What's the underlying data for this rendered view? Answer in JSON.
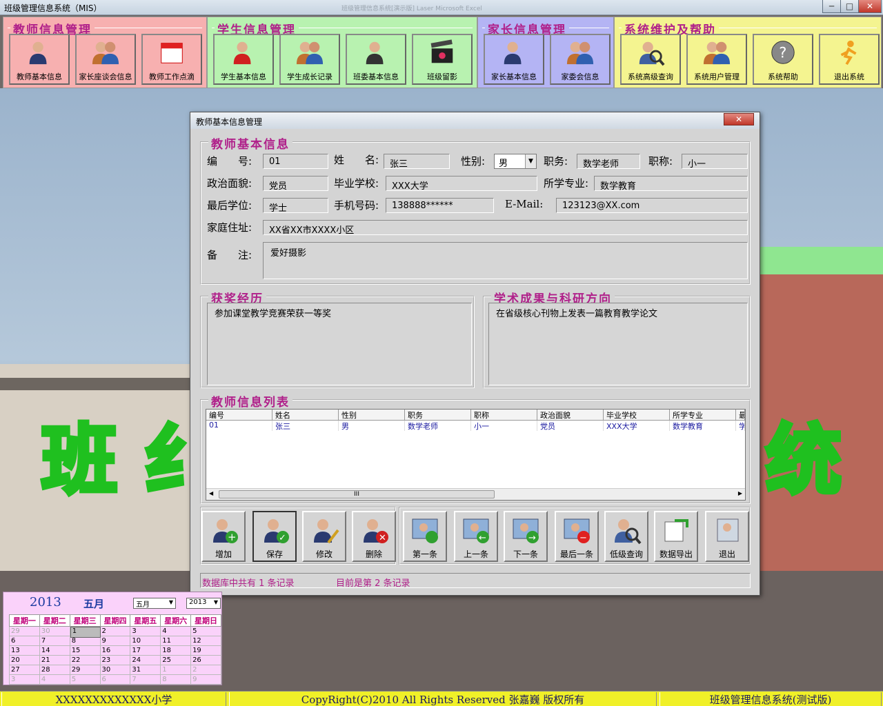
{
  "app": {
    "title": "班级管理信息系统（MIS）",
    "ghost_title": "班级管理信息系统[演示版] Laser    Microsoft Excel",
    "controls": {
      "minimize": "─",
      "maximize": "□",
      "close": "✕"
    }
  },
  "groups": [
    {
      "label": "教师信息管理",
      "bg": "#f7b0b0",
      "buttons": [
        {
          "label": "教师基本信息",
          "icon": "teacher-icon"
        },
        {
          "label": "家长座谈会信息",
          "icon": "parents-meeting-icon"
        },
        {
          "label": "教师工作点滴",
          "icon": "calendar-icon"
        }
      ]
    },
    {
      "label": "学生信息管理",
      "bg": "#b8f2b0",
      "buttons": [
        {
          "label": "学生基本信息",
          "icon": "student-icon"
        },
        {
          "label": "学生成长记录",
          "icon": "growth-record-icon"
        },
        {
          "label": "班委基本信息",
          "icon": "class-committee-icon"
        },
        {
          "label": "班级留影",
          "icon": "clapperboard-icon"
        }
      ]
    },
    {
      "label": "家长信息管理",
      "bg": "#b4b4f4",
      "buttons": [
        {
          "label": "家长基本信息",
          "icon": "parent-icon"
        },
        {
          "label": "家委会信息",
          "icon": "parent-committee-icon"
        }
      ]
    },
    {
      "label": "系统维护及帮助",
      "bg": "#f4f490",
      "buttons": [
        {
          "label": "系统高级查询",
          "icon": "advanced-search-icon"
        },
        {
          "label": "系统用户管理",
          "icon": "user-management-icon"
        },
        {
          "label": "系统帮助",
          "icon": "help-icon"
        },
        {
          "label": "退出系统",
          "icon": "exit-system-icon"
        }
      ]
    }
  ],
  "background": {
    "text_left": "班 纟",
    "text_right": "统"
  },
  "dialog": {
    "title": "教师基本信息管理",
    "close": "✕",
    "basic": {
      "legend": "教师基本信息",
      "labels": {
        "id": "编　　号:",
        "name": "姓　　名:",
        "gender": "性别:",
        "position": "职务:",
        "rank": "职称:",
        "politics": "政治面貌:",
        "school": "毕业学校:",
        "major": "所学专业:",
        "degree": "最后学位:",
        "phone": "手机号码:",
        "email": "E-Mail:",
        "address": "家庭住址:",
        "note": "备　　注:"
      },
      "values": {
        "id": "01",
        "name": "张三",
        "gender": "男",
        "position": "数学老师",
        "rank": "小一",
        "politics": "党员",
        "school": "XXX大学",
        "major": "数学教育",
        "degree": "学士",
        "phone": "138888******",
        "email": "123123@XX.com",
        "address": "XX省XX市XXXX小区",
        "note": "爱好摄影"
      }
    },
    "awards": {
      "legend": "获奖经历",
      "text": "参加课堂教学竞赛荣获一等奖"
    },
    "research": {
      "legend": "学术成果与科研方向",
      "text": "在省级核心刊物上发表一篇教育教学论文"
    },
    "list": {
      "legend": "教师信息列表",
      "columns": [
        "编号",
        "姓名",
        "性别",
        "职务",
        "职称",
        "政治面貌",
        "毕业学校",
        "所学专业",
        "最"
      ],
      "rows": [
        [
          "01",
          "张三",
          "男",
          "数学老师",
          "小一",
          "党员",
          "XXX大学",
          "数学教育",
          "学"
        ]
      ],
      "scroll_thumb": "III",
      "scroll_left": "◀",
      "scroll_right": "▶"
    },
    "actions": [
      {
        "label": "增加",
        "icon": "add-user-icon"
      },
      {
        "label": "保存",
        "icon": "save-user-icon"
      },
      {
        "label": "修改",
        "icon": "edit-user-icon"
      },
      {
        "label": "删除",
        "icon": "delete-user-icon"
      },
      {
        "label": "第一条",
        "icon": "first-record-icon"
      },
      {
        "label": "上一条",
        "icon": "previous-record-icon"
      },
      {
        "label": "下一条",
        "icon": "next-record-icon"
      },
      {
        "label": "最后一条",
        "icon": "last-record-icon"
      },
      {
        "label": "低级查询",
        "icon": "basic-search-icon"
      },
      {
        "label": "数据导出",
        "icon": "export-icon"
      },
      {
        "label": "退出",
        "icon": "exit-icon"
      }
    ],
    "status": {
      "total": "数据库中共有 1 条记录",
      "current": "目前是第 2 条记录"
    }
  },
  "calendar": {
    "year": "2013",
    "month": "五月",
    "month_select": "五月",
    "year_select": "2013",
    "weekdays": [
      "星期一",
      "星期二",
      "星期三",
      "星期四",
      "星期五",
      "星期六",
      "星期日"
    ],
    "weeks": [
      [
        "29",
        "30",
        "1",
        "2",
        "3",
        "4",
        "5"
      ],
      [
        "6",
        "7",
        "8",
        "9",
        "10",
        "11",
        "12"
      ],
      [
        "13",
        "14",
        "15",
        "16",
        "17",
        "18",
        "19"
      ],
      [
        "20",
        "21",
        "22",
        "23",
        "24",
        "25",
        "26"
      ],
      [
        "27",
        "28",
        "29",
        "30",
        "31",
        "1",
        "2"
      ],
      [
        "3",
        "4",
        "5",
        "6",
        "7",
        "8",
        "9"
      ]
    ]
  },
  "statusbar": {
    "school": "XXXXXXXXXXXXX小学",
    "copyright": "CopyRight(C)2010  All Rights Reserved 张嘉巍  版权所有",
    "system": "班级管理信息系统(测试版)"
  }
}
